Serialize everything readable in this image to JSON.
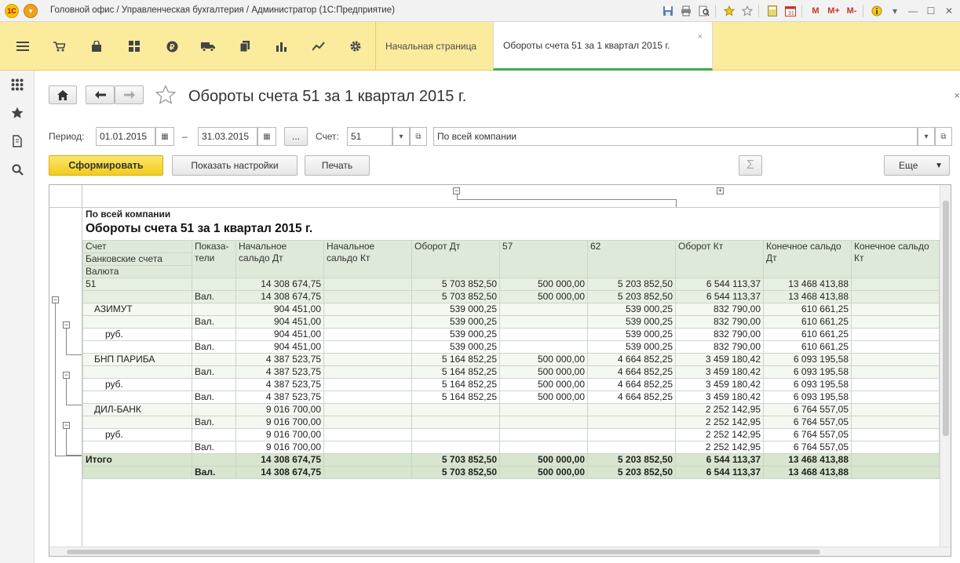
{
  "window": {
    "logo": "1С",
    "title": "Головной офис / Управленческая бухгалтерия / Администратор  (1С:Предприятие)",
    "title_icons": [
      "save-icon",
      "print-icon",
      "preview-icon",
      "favorite-add-icon",
      "star-icon",
      "calculator-icon",
      "calendar-icon"
    ],
    "memory_buttons": [
      "M",
      "M+",
      "M-"
    ]
  },
  "sections": {
    "icons": [
      "hamburger-icon",
      "cart-icon",
      "bag-icon",
      "grid-icon",
      "ruble-icon",
      "truck-icon",
      "documents-icon",
      "bar-chart-icon",
      "trend-icon",
      "gear-icon"
    ]
  },
  "tabs": [
    {
      "label": "Начальная страница"
    },
    {
      "label": "Обороты счета 51 за 1 квартал 2015 г.",
      "close": "×"
    }
  ],
  "leftpanel": {
    "icons": [
      "apps-icon",
      "star-icon",
      "history-icon",
      "search-icon"
    ]
  },
  "header": {
    "title": "Обороты счета 51 за 1 квартал 2015 г.",
    "close": "×"
  },
  "filters": {
    "period_label": "Период:",
    "date_from": "01.01.2015",
    "dash": "–",
    "date_to": "31.03.2015",
    "ellipsis": "...",
    "account_label": "Счет:",
    "account": "51",
    "organization": "По всей компании"
  },
  "actions": {
    "generate": "Сформировать",
    "settings": "Показать настройки",
    "print": "Печать",
    "sum": "Σ",
    "more": "Еще"
  },
  "report": {
    "company": "По всей компании",
    "title": "Обороты счета 51 за 1 квартал 2015 г.",
    "headers": {
      "account": "Счет",
      "bank_accounts": "Банковские счета",
      "currency": "Валюта",
      "indicators": "Показа-\nтели",
      "open_dt": "Начальное\nсальдо Дт",
      "open_kt": "Начальное\nсальдо Кт",
      "turn_dt": "Оборот Дт",
      "c57": "57",
      "c62": "62",
      "turn_kt": "Оборот Кт",
      "close_dt": "Конечное сальдо\nДт",
      "close_kt": "Конечное сальдо\nКт"
    },
    "rows": [
      {
        "kind": "acc",
        "name": "51",
        "ind": "",
        "odt": "14 308 674,75",
        "okt": "",
        "tdt": "5 703 852,50",
        "c57": "500 000,00",
        "c62": "5 203 852,50",
        "tkt": "6 544 113,37",
        "cdt": "13 468 413,88",
        "ckt": ""
      },
      {
        "kind": "acc",
        "name": "",
        "ind": "Вал.",
        "odt": "14 308 674,75",
        "okt": "",
        "tdt": "5 703 852,50",
        "c57": "500 000,00",
        "c62": "5 203 852,50",
        "tkt": "6 544 113,37",
        "cdt": "13 468 413,88",
        "ckt": ""
      },
      {
        "kind": "sub",
        "name": "АЗИМУТ",
        "ind": "",
        "odt": "904 451,00",
        "okt": "",
        "tdt": "539 000,25",
        "c57": "",
        "c62": "539 000,25",
        "tkt": "832 790,00",
        "cdt": "610 661,25",
        "ckt": ""
      },
      {
        "kind": "sub",
        "name": "",
        "ind": "Вал.",
        "odt": "904 451,00",
        "okt": "",
        "tdt": "539 000,25",
        "c57": "",
        "c62": "539 000,25",
        "tkt": "832 790,00",
        "cdt": "610 661,25",
        "ckt": ""
      },
      {
        "kind": "leaf",
        "name": "руб.",
        "ind": "",
        "odt": "904 451,00",
        "okt": "",
        "tdt": "539 000,25",
        "c57": "",
        "c62": "539 000,25",
        "tkt": "832 790,00",
        "cdt": "610 661,25",
        "ckt": ""
      },
      {
        "kind": "leaf",
        "name": "",
        "ind": "Вал.",
        "odt": "904 451,00",
        "okt": "",
        "tdt": "539 000,25",
        "c57": "",
        "c62": "539 000,25",
        "tkt": "832 790,00",
        "cdt": "610 661,25",
        "ckt": ""
      },
      {
        "kind": "sub",
        "name": "БНП ПАРИБА",
        "ind": "",
        "odt": "4 387 523,75",
        "okt": "",
        "tdt": "5 164 852,25",
        "c57": "500 000,00",
        "c62": "4 664 852,25",
        "tkt": "3 459 180,42",
        "cdt": "6 093 195,58",
        "ckt": ""
      },
      {
        "kind": "sub",
        "name": "",
        "ind": "Вал.",
        "odt": "4 387 523,75",
        "okt": "",
        "tdt": "5 164 852,25",
        "c57": "500 000,00",
        "c62": "4 664 852,25",
        "tkt": "3 459 180,42",
        "cdt": "6 093 195,58",
        "ckt": ""
      },
      {
        "kind": "leaf",
        "name": "руб.",
        "ind": "",
        "odt": "4 387 523,75",
        "okt": "",
        "tdt": "5 164 852,25",
        "c57": "500 000,00",
        "c62": "4 664 852,25",
        "tkt": "3 459 180,42",
        "cdt": "6 093 195,58",
        "ckt": ""
      },
      {
        "kind": "leaf",
        "name": "",
        "ind": "Вал.",
        "odt": "4 387 523,75",
        "okt": "",
        "tdt": "5 164 852,25",
        "c57": "500 000,00",
        "c62": "4 664 852,25",
        "tkt": "3 459 180,42",
        "cdt": "6 093 195,58",
        "ckt": ""
      },
      {
        "kind": "sub",
        "name": "ДИЛ-БАНК",
        "ind": "",
        "odt": "9 016 700,00",
        "okt": "",
        "tdt": "",
        "c57": "",
        "c62": "",
        "tkt": "2 252 142,95",
        "cdt": "6 764 557,05",
        "ckt": ""
      },
      {
        "kind": "sub",
        "name": "",
        "ind": "Вал.",
        "odt": "9 016 700,00",
        "okt": "",
        "tdt": "",
        "c57": "",
        "c62": "",
        "tkt": "2 252 142,95",
        "cdt": "6 764 557,05",
        "ckt": ""
      },
      {
        "kind": "leaf",
        "name": "руб.",
        "ind": "",
        "odt": "9 016 700,00",
        "okt": "",
        "tdt": "",
        "c57": "",
        "c62": "",
        "tkt": "2 252 142,95",
        "cdt": "6 764 557,05",
        "ckt": ""
      },
      {
        "kind": "leaf",
        "name": "",
        "ind": "Вал.",
        "odt": "9 016 700,00",
        "okt": "",
        "tdt": "",
        "c57": "",
        "c62": "",
        "tkt": "2 252 142,95",
        "cdt": "6 764 557,05",
        "ckt": ""
      },
      {
        "kind": "total",
        "name": "Итого",
        "ind": "",
        "odt": "14 308 674,75",
        "okt": "",
        "tdt": "5 703 852,50",
        "c57": "500 000,00",
        "c62": "5 203 852,50",
        "tkt": "6 544 113,37",
        "cdt": "13 468 413,88",
        "ckt": ""
      },
      {
        "kind": "total",
        "name": "",
        "ind": "Вал.",
        "odt": "14 308 674,75",
        "okt": "",
        "tdt": "5 703 852,50",
        "c57": "500 000,00",
        "c62": "5 203 852,50",
        "tkt": "6 544 113,37",
        "cdt": "13 468 413,88",
        "ckt": ""
      }
    ]
  }
}
